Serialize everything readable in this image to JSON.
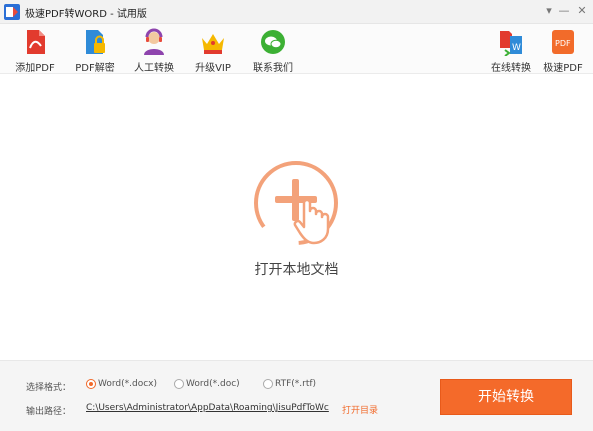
{
  "window": {
    "title": "极速PDF转WORD - 试用版",
    "minimize": "▾",
    "min2": "—",
    "close": "✕"
  },
  "toolbar": {
    "left": [
      {
        "label": "添加PDF",
        "icon": "add-pdf-icon"
      },
      {
        "label": "PDF解密",
        "icon": "pdf-decrypt-icon"
      },
      {
        "label": "人工转换",
        "icon": "manual-service-icon"
      },
      {
        "label": "升级VIP",
        "icon": "vip-crown-icon"
      },
      {
        "label": "联系我们",
        "icon": "wechat-contact-icon"
      }
    ],
    "right": [
      {
        "label": "在线转换",
        "icon": "online-convert-icon"
      },
      {
        "label": "极速PDF",
        "icon": "jisu-pdf-icon"
      }
    ]
  },
  "main": {
    "open_label": "打开本地文档"
  },
  "bottom": {
    "format_label": "选择格式：",
    "formats": [
      {
        "label": "Word(*.docx)",
        "checked": true
      },
      {
        "label": "Word(*.doc)",
        "checked": false
      },
      {
        "label": "RTF(*.rtf)",
        "checked": false
      }
    ],
    "path_label": "输出路径：",
    "path_value": "C:\\Users\\Administrator\\AppData\\Roaming\\JisuPdfToWc",
    "open_dir": "打开目录",
    "start_button": "开始转换"
  },
  "colors": {
    "accent": "#f46a2a",
    "circle": "#f3a27a"
  }
}
